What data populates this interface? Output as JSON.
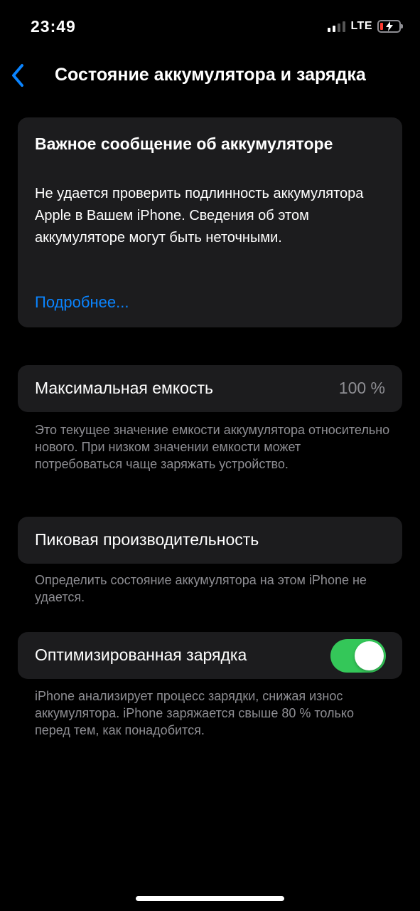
{
  "status_bar": {
    "time": "23:49",
    "network": "LTE",
    "battery_color": "#ff3b30"
  },
  "nav": {
    "back_icon": "chevron-left-icon",
    "title": "Состояние аккумулятора и зарядка"
  },
  "alert": {
    "title": "Важное сообщение об аккумуляторе",
    "body": "Не удается проверить подлинность аккумулятора Apple в Вашем iPhone. Сведения об этом аккумуляторе могут быть неточными.",
    "link": "Подробнее..."
  },
  "capacity": {
    "label": "Максимальная емкость",
    "value": "100 %",
    "footnote": "Это текущее значение емкости аккумулятора относительно нового. При низком значении емкости может потребоваться чаще заряжать устройство."
  },
  "peak": {
    "label": "Пиковая производительность",
    "footnote": "Определить состояние аккумулятора на этом iPhone не удается."
  },
  "optimized_charging": {
    "label": "Оптимизированная зарядка",
    "enabled": true,
    "toggle_color": "#34c759",
    "footnote": "iPhone анализирует процесс зарядки, снижая износ аккумулятора. iPhone заряжается свыше 80 % только перед тем, как понадобится."
  },
  "colors": {
    "accent": "#0a84ff",
    "card_bg": "#1c1c1e",
    "secondary_text": "#8e8e93"
  }
}
